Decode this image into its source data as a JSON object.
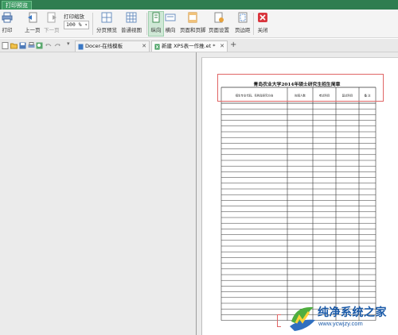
{
  "window": {
    "tab_title": "打印预览"
  },
  "ribbon": {
    "print_label": "打印",
    "prev_page_label": "上一页",
    "next_page_label": "下一页",
    "zoom_label": "打印缩放",
    "zoom_value": "100 %",
    "page_break_preview_label": "分页预览",
    "normal_view_label": "普通视图",
    "portrait_label": "纵向",
    "landscape_label": "横向",
    "header_footer_label": "页面和页脚",
    "page_setup_label": "页面设置",
    "margins_label": "页边距",
    "close_label": "关闭"
  },
  "tabs": [
    {
      "label": "Docer-在线模板"
    },
    {
      "label": "新建 XPS表一作推.et *"
    }
  ],
  "document": {
    "title": "青岛农业大学2014年硕士研究生招生简章",
    "columns": [
      "招生专业代码、名称及研究方向",
      "拟招人数",
      "考试科目",
      "复试科目",
      "备 注"
    ],
    "row_count": 38
  },
  "watermark": {
    "name": "纯净系统之家",
    "url": "www.ycwjzy.com"
  },
  "colors": {
    "titlebar": "#2f7d50",
    "highlight": "#e06565",
    "watermark": "#1a5aa8"
  }
}
